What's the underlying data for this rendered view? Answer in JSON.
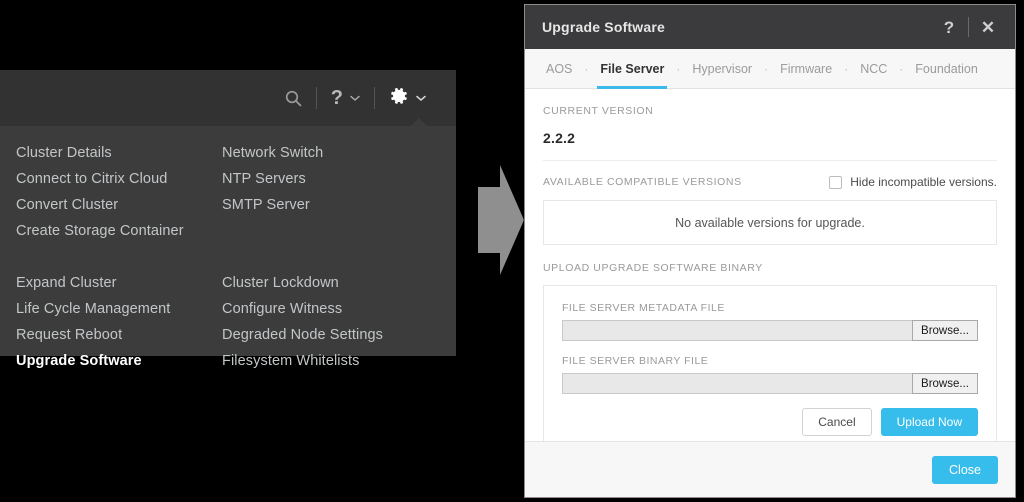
{
  "settings_menu": {
    "toolbar": {
      "search_icon": "search-icon",
      "help_label": "?",
      "help_chevron": "chevron-down-icon",
      "gear_icon": "gear-icon",
      "gear_chevron": "chevron-down-icon"
    },
    "columns": [
      {
        "items": [
          {
            "label": "Cluster Details",
            "active": false
          },
          {
            "label": "Connect to Citrix Cloud",
            "active": false
          },
          {
            "label": "Convert Cluster",
            "active": false
          },
          {
            "label": "Create Storage Container",
            "active": false
          },
          {
            "label": "",
            "active": false
          },
          {
            "label": "Expand Cluster",
            "active": false
          },
          {
            "label": "Life Cycle Management",
            "active": false
          },
          {
            "label": "Request Reboot",
            "active": false
          },
          {
            "label": "Upgrade Software",
            "active": true
          }
        ]
      },
      {
        "items": [
          {
            "label": "Network Switch",
            "active": false
          },
          {
            "label": "NTP Servers",
            "active": false
          },
          {
            "label": "SMTP Server",
            "active": false
          },
          {
            "label": "",
            "active": false
          },
          {
            "label": "",
            "active": false
          },
          {
            "label": "Cluster Lockdown",
            "active": false
          },
          {
            "label": "Configure Witness",
            "active": false
          },
          {
            "label": "Degraded Node Settings",
            "active": false
          },
          {
            "label": "Filesystem Whitelists",
            "active": false
          }
        ]
      }
    ]
  },
  "arrow": {
    "name": "flow-arrow-right",
    "color": "#8f8f8f"
  },
  "dialog": {
    "title": "Upgrade Software",
    "help_button": "?",
    "close_button": "✕",
    "tabs": [
      {
        "label": "AOS",
        "active": false
      },
      {
        "label": "File Server",
        "active": true
      },
      {
        "label": "Hypervisor",
        "active": false
      },
      {
        "label": "Firmware",
        "active": false
      },
      {
        "label": "NCC",
        "active": false
      },
      {
        "label": "Foundation",
        "active": false
      }
    ],
    "tab_separator": "·",
    "current_version": {
      "label": "CURRENT VERSION",
      "value": "2.2.2"
    },
    "available_versions": {
      "label": "AVAILABLE COMPATIBLE VERSIONS",
      "hide_incompatible_label": "Hide incompatible versions.",
      "hide_incompatible_checked": false,
      "empty_message": "No available versions for upgrade."
    },
    "upload": {
      "label": "UPLOAD UPGRADE SOFTWARE BINARY",
      "metadata_field": {
        "label": "FILE SERVER METADATA FILE",
        "value": "",
        "browse_label": "Browse..."
      },
      "binary_field": {
        "label": "FILE SERVER BINARY FILE",
        "value": "",
        "browse_label": "Browse..."
      },
      "cancel_label": "Cancel",
      "upload_label": "Upload Now"
    },
    "footer": {
      "close_label": "Close"
    }
  },
  "colors": {
    "accent": "#36bdeb",
    "tab_underline": "#3cb9e8",
    "menu_bar": "#323232",
    "menu_dropdown": "#3c3c3c",
    "dialog_titlebar": "#3b3b3d",
    "page_background": "#000000"
  }
}
